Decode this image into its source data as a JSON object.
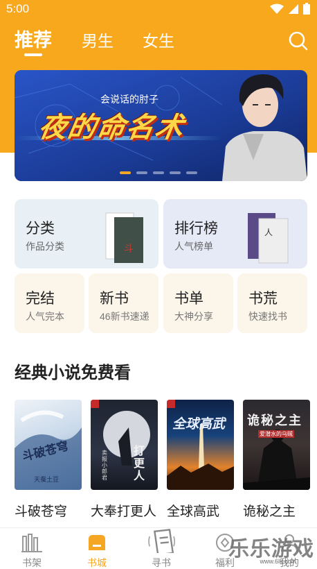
{
  "status": {
    "time": "5:00"
  },
  "tabs": [
    {
      "label": "推荐"
    },
    {
      "label": "男生"
    },
    {
      "label": "女生"
    }
  ],
  "banner": {
    "author": "会说话的肘子",
    "title": "夜的命名术"
  },
  "categories": {
    "big": [
      {
        "title": "分类",
        "subtitle": "作品分类"
      },
      {
        "title": "排行榜",
        "subtitle": "人气榜单"
      }
    ],
    "small": [
      {
        "title": "完结",
        "subtitle": "人气完本"
      },
      {
        "title": "新书",
        "subtitle": "46新书速递"
      },
      {
        "title": "书单",
        "subtitle": "大神分享"
      },
      {
        "title": "书荒",
        "subtitle": "快速找书"
      }
    ]
  },
  "section": {
    "title": "经典小说免费看"
  },
  "books": [
    {
      "name": "斗破苍穹",
      "cover_text": "斗破苍穹",
      "cover_author": "天蚕土豆"
    },
    {
      "name": "大奉打更人",
      "cover_text": "打更人",
      "cover_author": "卖报小郎君"
    },
    {
      "name": "全球高武",
      "cover_text": "全球高武",
      "cover_author": ""
    },
    {
      "name": "诡秘之主",
      "cover_text": "诡秘之主",
      "cover_author": "爱潜水的乌贼"
    }
  ],
  "bottom_nav": [
    {
      "label": "书架",
      "icon": "bookshelf-icon"
    },
    {
      "label": "书城",
      "icon": "bookstore-icon"
    },
    {
      "label": "寻书",
      "icon": "find-book-icon"
    },
    {
      "label": "福利",
      "icon": "welfare-icon"
    },
    {
      "label": "我的",
      "icon": "profile-icon"
    }
  ],
  "watermark": {
    "text": "乐乐游戏",
    "url": "www.6lk.com"
  },
  "colors": {
    "accent": "#f7a81c",
    "active_nav": "#f5a623"
  }
}
